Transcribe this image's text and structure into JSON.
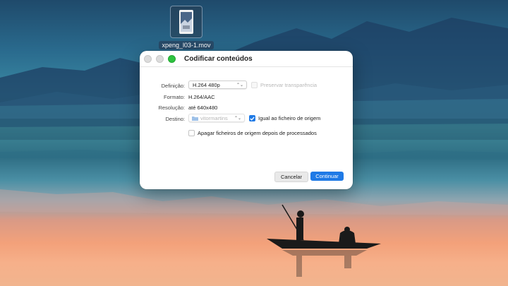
{
  "desktop": {
    "file_name": "xpeng_l03-1.mov",
    "file_icon": "video-thumbnail-icon"
  },
  "dialog": {
    "title": "Codificar conteúdos",
    "setting_label": "Definição:",
    "setting_value": "H.264 480p",
    "preserve_transparency": "Preservar transparência",
    "format_label": "Formato:",
    "format_value": "H.264/AAC",
    "resolution_label": "Resolução:",
    "resolution_value": "até 640x480",
    "destination_label": "Destino:",
    "destination_value": "vitormartins",
    "same_as_source": "Igual ao ficheiro de origem",
    "delete_sources": "Apagar ficheiros de origem depois de processados",
    "cancel": "Cancelar",
    "continue": "Continuar"
  },
  "colors": {
    "accent": "#1f7ae6",
    "close_green": "#2dc33f"
  }
}
